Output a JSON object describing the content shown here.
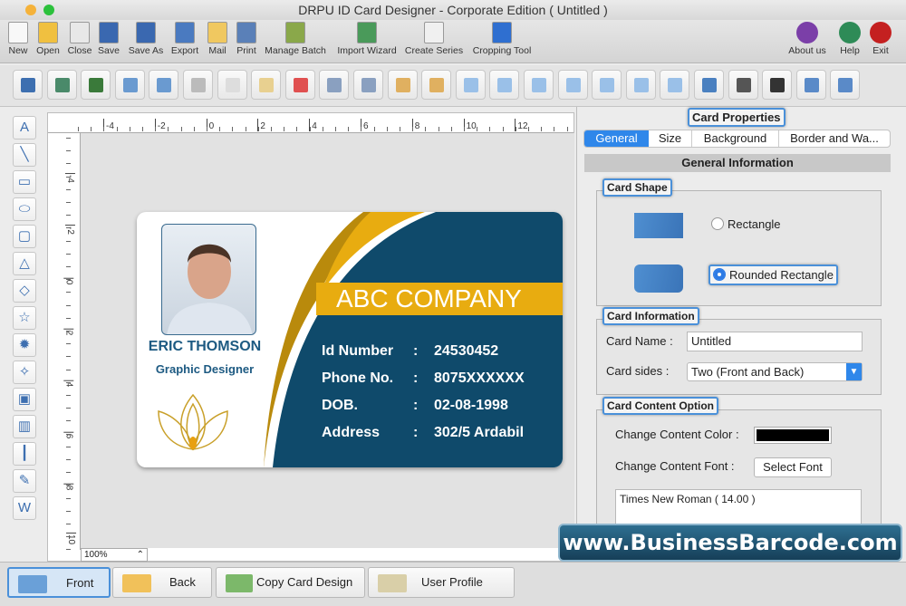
{
  "window": {
    "title": "DRPU ID Card Designer - Corporate Edition ( Untitled )"
  },
  "main_toolbar": [
    {
      "label": "New",
      "icon": "new-document-icon"
    },
    {
      "label": "Open",
      "icon": "open-folder-icon"
    },
    {
      "label": "Close",
      "icon": "close-document-icon"
    },
    {
      "label": "Save",
      "icon": "save-icon"
    },
    {
      "label": "Save As",
      "icon": "save-as-icon"
    },
    {
      "label": "Export",
      "icon": "export-icon"
    },
    {
      "label": "Mail",
      "icon": "mail-icon"
    },
    {
      "label": "Print",
      "icon": "printer-icon"
    },
    {
      "label": "Manage Batch",
      "icon": "manage-batch-icon"
    },
    {
      "label": "Import Wizard",
      "icon": "import-wizard-icon"
    },
    {
      "label": "Create Series",
      "icon": "sigma-function-icon"
    },
    {
      "label": "Cropping Tool",
      "icon": "crop-icon"
    }
  ],
  "right_toolbar": [
    {
      "label": "About us",
      "icon": "info-icon",
      "color": "#7b3fa8"
    },
    {
      "label": "Help",
      "icon": "help-icon",
      "color": "#2e8b57"
    },
    {
      "label": "Exit",
      "icon": "exit-icon",
      "color": "#c42020"
    }
  ],
  "ruler": {
    "h_ticks": [
      "-4",
      "-2",
      "0",
      "2",
      "4",
      "6",
      "8",
      "10",
      "12"
    ],
    "v_ticks": [
      "-4",
      "-2",
      "0",
      "2",
      "4",
      "6",
      "8",
      "10"
    ]
  },
  "zoom": "100%",
  "card": {
    "name": "ERIC THOMSON",
    "title": "Graphic Designer",
    "company": "ABC COMPANY",
    "fields": [
      {
        "label": "Id Number",
        "sep": ":",
        "value": "24530452"
      },
      {
        "label": "Phone No.",
        "sep": ":",
        "value": "8075XXXXXX"
      },
      {
        "label": "DOB.",
        "sep": ":",
        "value": "02-08-1998"
      },
      {
        "label": "Address",
        "sep": ":",
        "value": "302/5 Ardabil"
      }
    ],
    "colors": {
      "navy": "#0f4a6b",
      "gold": "#e8ac10",
      "name": "#1d5a82"
    }
  },
  "panel": {
    "title": "Card Properties",
    "tabs": [
      "General",
      "Size",
      "Background",
      "Border and Wa..."
    ],
    "active_tab": "General",
    "section_title": "General Information",
    "card_shape": {
      "title": "Card Shape",
      "options": [
        "Rectangle",
        "Rounded Rectangle"
      ],
      "selected": "Rounded Rectangle"
    },
    "card_info": {
      "title": "Card Information",
      "name_label": "Card Name :",
      "name_value": "Untitled",
      "sides_label": "Card sides :",
      "sides_value": "Two (Front and Back)"
    },
    "content": {
      "title": "Card Content Option",
      "color_label": "Change Content Color :",
      "color_value": "#000000",
      "font_label": "Change Content Font :",
      "font_button": "Select Font",
      "font_value": "Times New Roman ( 14.00 )"
    }
  },
  "bottom": {
    "buttons": [
      "Front",
      "Back",
      "Copy Card Design",
      "User Profile"
    ],
    "active": "Front"
  },
  "watermark": "www.BusinessBarcode.com"
}
